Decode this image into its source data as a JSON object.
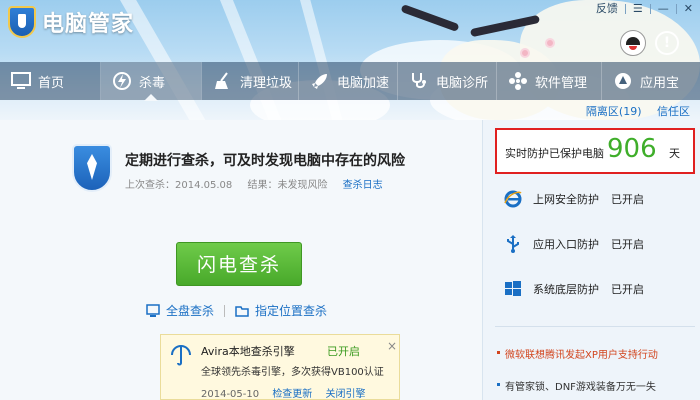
{
  "app": {
    "title": "电脑管家",
    "window_controls": [
      "反馈",
      "☰",
      "—",
      "✕"
    ]
  },
  "nav": {
    "items": [
      {
        "label": "首页",
        "icon": "monitor-icon"
      },
      {
        "label": "杀毒",
        "icon": "lightning-shield-icon",
        "active": true
      },
      {
        "label": "清理垃圾",
        "icon": "broom-icon"
      },
      {
        "label": "电脑加速",
        "icon": "rocket-icon"
      },
      {
        "label": "电脑诊所",
        "icon": "stethoscope-icon"
      },
      {
        "label": "软件管理",
        "icon": "puzzle-icon"
      },
      {
        "label": "应用宝",
        "icon": "app-store-icon"
      }
    ]
  },
  "sublinks": [
    "隔离区(19)",
    "信任区"
  ],
  "main": {
    "headline": "定期进行查杀，可及时发现电脑中存在的风险",
    "last_scan_label": "上次查杀：2014.05.08",
    "result_label": "结果：未发现风险",
    "log_link": "查杀日志",
    "flash_button": "闪电查杀",
    "full_scan": "全盘查杀",
    "custom_scan": "指定位置查杀"
  },
  "engine": {
    "title": "Avira本地查杀引擎",
    "status": "已开启",
    "close": "×",
    "desc": "全球领先杀毒引擎，多次获得VB100认证",
    "date": "2014-05-10",
    "link1": "检查更新",
    "link2": "关闭引擎"
  },
  "side": {
    "protect_label": "实时防护已保护电脑",
    "protect_days": "906",
    "protect_unit": "天",
    "rows": [
      {
        "label": "上网安全防护",
        "status": "已开启",
        "icon": "ie-icon"
      },
      {
        "label": "应用入口防护",
        "status": "已开启",
        "icon": "usb-icon"
      },
      {
        "label": "系统底层防护",
        "status": "已开启",
        "icon": "windows-icon"
      }
    ],
    "news": [
      "微软联想腾讯发起XP用户支持行动",
      "有管家锁、DNF游戏装备万无一失"
    ]
  },
  "colors": {
    "accent_green": "#48a92a",
    "link_blue": "#1a6fc4",
    "highlight_red": "#e02020",
    "days_green": "#3fae2a"
  }
}
